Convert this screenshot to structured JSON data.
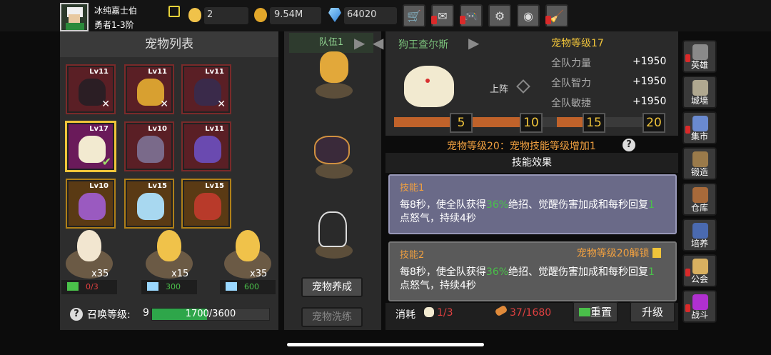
{
  "player": {
    "name": "冰纯嘉士伯",
    "rank": "勇者1-3阶"
  },
  "resources": {
    "eggs": "2",
    "gold": "9.54M",
    "gems": "64020"
  },
  "toolbar": [
    "shop-cart-icon",
    "mail-icon",
    "gamepad-icon",
    "settings-gear-icon",
    "color-wheel-icon",
    "broom-icon"
  ],
  "left_panel": {
    "title": "宠物列表",
    "pets": [
      {
        "level": "Lv11",
        "icon": "reaper-pet",
        "color": "#2b1e24"
      },
      {
        "level": "Lv11",
        "icon": "flame-skull-pet",
        "color": "#d8a030"
      },
      {
        "level": "Lv11",
        "icon": "demon-bat-pet",
        "color": "#3a2a4a"
      },
      {
        "level": "Lv17",
        "icon": "white-dog-pet",
        "color": "#f2ead0"
      },
      {
        "level": "Lv10",
        "icon": "bat-pet",
        "color": "#7a6a8a"
      },
      {
        "level": "Lv11",
        "icon": "purple-horse-pet",
        "color": "#6a4ab0"
      },
      {
        "level": "Lv10",
        "icon": "scorpion-pet",
        "color": "#9a5ac0"
      },
      {
        "level": "Lv15",
        "icon": "ice-wolf-pet",
        "color": "#a8d8f0"
      },
      {
        "level": "Lv15",
        "icon": "lava-beast-pet",
        "color": "#b83a2a"
      }
    ],
    "eggs": [
      {
        "count": "x35",
        "bar_text": "0/3",
        "bar_color": "#e04040"
      },
      {
        "count": "x15",
        "bar_text": "300",
        "bar_color": "#4ac04a"
      },
      {
        "count": "x35",
        "bar_text": "600",
        "bar_color": "#4ac04a"
      }
    ],
    "summon_label": "召唤等级:",
    "summon_level": "9",
    "summon_progress": "1700/3600",
    "summon_fraction": 0.47
  },
  "middle_panel": {
    "team_label": "队伍1",
    "train_button": "宠物养成",
    "wash_button": "宠物洗练"
  },
  "detail": {
    "pet_name": "狗王查尔斯",
    "pet_level": "宠物等级17",
    "deploy_label": "上阵",
    "stats": [
      {
        "name": "全队力量",
        "value": "+1950"
      },
      {
        "name": "全队智力",
        "value": "+1950"
      },
      {
        "name": "全队敏捷",
        "value": "+1950"
      }
    ],
    "milestones": [
      "5",
      "10",
      "15",
      "20"
    ],
    "note": "宠物等级20：宠物技能等级增加1",
    "skill_header": "技能效果",
    "skills": [
      {
        "title": "技能1",
        "text_a": "每8秒，使全队获得",
        "pct": "36%",
        "text_b": "绝招、觉醒伤害加成和每秒回复",
        "num": "1",
        "text_c": "点怒气，持续4秒"
      },
      {
        "title": "技能2",
        "lock": "宠物等级20解锁",
        "text_a": "每8秒，使全队获得",
        "pct": "36%",
        "text_b": "绝招、觉醒伤害加成和每秒回复",
        "num": "1",
        "text_c": "点怒气，持续4秒"
      }
    ],
    "cost_label": "消耗",
    "cost_a": "1/3",
    "cost_b": "37/1680",
    "reset_button": "重置",
    "upgrade_button": "升级"
  },
  "sidebar": [
    {
      "label": "英雄",
      "icon": "helmet-icon",
      "color": "#8a8a8a"
    },
    {
      "label": "城墙",
      "icon": "castle-wall-icon",
      "color": "#b0a890"
    },
    {
      "label": "集市",
      "icon": "market-icon",
      "color": "#6a8ad0"
    },
    {
      "label": "锻造",
      "icon": "anvil-icon",
      "color": "#9a7a4a"
    },
    {
      "label": "仓库",
      "icon": "warehouse-icon",
      "color": "#a86a3a"
    },
    {
      "label": "培养",
      "icon": "training-icon",
      "color": "#4a6ab0"
    },
    {
      "label": "公会",
      "icon": "guild-icon",
      "color": "#d8b060"
    },
    {
      "label": "战斗",
      "icon": "portal-icon",
      "color": "#b030d0"
    }
  ]
}
